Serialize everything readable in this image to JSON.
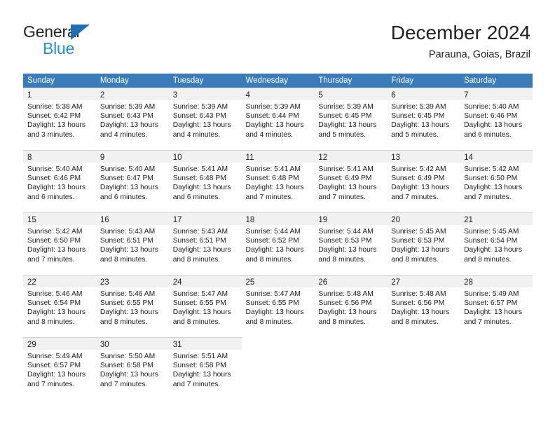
{
  "brand": {
    "name_part1": "General",
    "name_part2": "Blue",
    "triangle_icon": "triangle-icon",
    "accent_color": "#1f8fd6",
    "triangle_color": "#1f6fb5"
  },
  "header": {
    "title": "December 2024",
    "subtitle": "Parauna, Goias, Brazil"
  },
  "calendar": {
    "header_bg": "#3a7cba",
    "daynum_band_bg": "#f1f1f1",
    "weekdays": [
      "Sunday",
      "Monday",
      "Tuesday",
      "Wednesday",
      "Thursday",
      "Friday",
      "Saturday"
    ],
    "weeks": [
      [
        {
          "day": "1",
          "sunrise": "Sunrise: 5:38 AM",
          "sunset": "Sunset: 6:42 PM",
          "daylight": "Daylight: 13 hours and 3 minutes."
        },
        {
          "day": "2",
          "sunrise": "Sunrise: 5:39 AM",
          "sunset": "Sunset: 6:43 PM",
          "daylight": "Daylight: 13 hours and 4 minutes."
        },
        {
          "day": "3",
          "sunrise": "Sunrise: 5:39 AM",
          "sunset": "Sunset: 6:43 PM",
          "daylight": "Daylight: 13 hours and 4 minutes."
        },
        {
          "day": "4",
          "sunrise": "Sunrise: 5:39 AM",
          "sunset": "Sunset: 6:44 PM",
          "daylight": "Daylight: 13 hours and 4 minutes."
        },
        {
          "day": "5",
          "sunrise": "Sunrise: 5:39 AM",
          "sunset": "Sunset: 6:45 PM",
          "daylight": "Daylight: 13 hours and 5 minutes."
        },
        {
          "day": "6",
          "sunrise": "Sunrise: 5:39 AM",
          "sunset": "Sunset: 6:45 PM",
          "daylight": "Daylight: 13 hours and 5 minutes."
        },
        {
          "day": "7",
          "sunrise": "Sunrise: 5:40 AM",
          "sunset": "Sunset: 6:46 PM",
          "daylight": "Daylight: 13 hours and 6 minutes."
        }
      ],
      [
        {
          "day": "8",
          "sunrise": "Sunrise: 5:40 AM",
          "sunset": "Sunset: 6:46 PM",
          "daylight": "Daylight: 13 hours and 6 minutes."
        },
        {
          "day": "9",
          "sunrise": "Sunrise: 5:40 AM",
          "sunset": "Sunset: 6:47 PM",
          "daylight": "Daylight: 13 hours and 6 minutes."
        },
        {
          "day": "10",
          "sunrise": "Sunrise: 5:41 AM",
          "sunset": "Sunset: 6:48 PM",
          "daylight": "Daylight: 13 hours and 6 minutes."
        },
        {
          "day": "11",
          "sunrise": "Sunrise: 5:41 AM",
          "sunset": "Sunset: 6:48 PM",
          "daylight": "Daylight: 13 hours and 7 minutes."
        },
        {
          "day": "12",
          "sunrise": "Sunrise: 5:41 AM",
          "sunset": "Sunset: 6:49 PM",
          "daylight": "Daylight: 13 hours and 7 minutes."
        },
        {
          "day": "13",
          "sunrise": "Sunrise: 5:42 AM",
          "sunset": "Sunset: 6:49 PM",
          "daylight": "Daylight: 13 hours and 7 minutes."
        },
        {
          "day": "14",
          "sunrise": "Sunrise: 5:42 AM",
          "sunset": "Sunset: 6:50 PM",
          "daylight": "Daylight: 13 hours and 7 minutes."
        }
      ],
      [
        {
          "day": "15",
          "sunrise": "Sunrise: 5:42 AM",
          "sunset": "Sunset: 6:50 PM",
          "daylight": "Daylight: 13 hours and 7 minutes."
        },
        {
          "day": "16",
          "sunrise": "Sunrise: 5:43 AM",
          "sunset": "Sunset: 6:51 PM",
          "daylight": "Daylight: 13 hours and 8 minutes."
        },
        {
          "day": "17",
          "sunrise": "Sunrise: 5:43 AM",
          "sunset": "Sunset: 6:51 PM",
          "daylight": "Daylight: 13 hours and 8 minutes."
        },
        {
          "day": "18",
          "sunrise": "Sunrise: 5:44 AM",
          "sunset": "Sunset: 6:52 PM",
          "daylight": "Daylight: 13 hours and 8 minutes."
        },
        {
          "day": "19",
          "sunrise": "Sunrise: 5:44 AM",
          "sunset": "Sunset: 6:53 PM",
          "daylight": "Daylight: 13 hours and 8 minutes."
        },
        {
          "day": "20",
          "sunrise": "Sunrise: 5:45 AM",
          "sunset": "Sunset: 6:53 PM",
          "daylight": "Daylight: 13 hours and 8 minutes."
        },
        {
          "day": "21",
          "sunrise": "Sunrise: 5:45 AM",
          "sunset": "Sunset: 6:54 PM",
          "daylight": "Daylight: 13 hours and 8 minutes."
        }
      ],
      [
        {
          "day": "22",
          "sunrise": "Sunrise: 5:46 AM",
          "sunset": "Sunset: 6:54 PM",
          "daylight": "Daylight: 13 hours and 8 minutes."
        },
        {
          "day": "23",
          "sunrise": "Sunrise: 5:46 AM",
          "sunset": "Sunset: 6:55 PM",
          "daylight": "Daylight: 13 hours and 8 minutes."
        },
        {
          "day": "24",
          "sunrise": "Sunrise: 5:47 AM",
          "sunset": "Sunset: 6:55 PM",
          "daylight": "Daylight: 13 hours and 8 minutes."
        },
        {
          "day": "25",
          "sunrise": "Sunrise: 5:47 AM",
          "sunset": "Sunset: 6:55 PM",
          "daylight": "Daylight: 13 hours and 8 minutes."
        },
        {
          "day": "26",
          "sunrise": "Sunrise: 5:48 AM",
          "sunset": "Sunset: 6:56 PM",
          "daylight": "Daylight: 13 hours and 8 minutes."
        },
        {
          "day": "27",
          "sunrise": "Sunrise: 5:48 AM",
          "sunset": "Sunset: 6:56 PM",
          "daylight": "Daylight: 13 hours and 8 minutes."
        },
        {
          "day": "28",
          "sunrise": "Sunrise: 5:49 AM",
          "sunset": "Sunset: 6:57 PM",
          "daylight": "Daylight: 13 hours and 7 minutes."
        }
      ],
      [
        {
          "day": "29",
          "sunrise": "Sunrise: 5:49 AM",
          "sunset": "Sunset: 6:57 PM",
          "daylight": "Daylight: 13 hours and 7 minutes."
        },
        {
          "day": "30",
          "sunrise": "Sunrise: 5:50 AM",
          "sunset": "Sunset: 6:58 PM",
          "daylight": "Daylight: 13 hours and 7 minutes."
        },
        {
          "day": "31",
          "sunrise": "Sunrise: 5:51 AM",
          "sunset": "Sunset: 6:58 PM",
          "daylight": "Daylight: 13 hours and 7 minutes."
        },
        null,
        null,
        null,
        null
      ]
    ]
  }
}
